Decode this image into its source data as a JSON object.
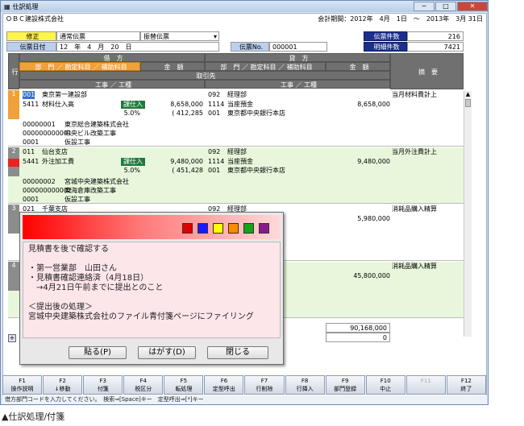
{
  "window": {
    "title": "仕訳処理",
    "company": "ＯＢＣ建設株式会社",
    "period": "会計期間：2012年　4月　1日　～　2013年　3月 31日"
  },
  "header": {
    "mode": "修正",
    "voucher": "通常伝票",
    "transfer": "振替伝票",
    "date_label": "伝票日付",
    "date_value": "12　年　4　月　20　日",
    "voucher_no_label": "伝票No.",
    "voucher_no": "000001",
    "count_label": "伝票件数",
    "count_value": "216",
    "detail_label": "明細件数",
    "detail_value": "7421"
  },
  "columns": {
    "row": "行",
    "debit": "借　方",
    "credit": "貸　方",
    "dept_acct": "部　門 ／ 勘定科目 ／ 補助科目",
    "amount": "金　額",
    "partner": "取引先",
    "project": "工事 ／ 工種",
    "summary": "摘　要"
  },
  "rows": [
    {
      "no": "1",
      "d_dept": "001",
      "d_dept_name": "東京第一建設部",
      "d_acct": "5411",
      "d_acct_name": "材料仕入高",
      "badge": "課仕入",
      "d_amount": "8,658,000",
      "d_tax": "( 412,285",
      "d_rate": "5.0%",
      "c_dept": "092",
      "c_dept_name": "経理部",
      "c_acct": "1114",
      "c_acct_name": "当座預金",
      "c_sub": "001",
      "c_sub_name": "東京都中央銀行本店",
      "c_amount": "8,658,000",
      "summary": "当月材料費計上",
      "p1": "00000001",
      "p1n": "東京総合建築株式会社",
      "p2": "000000000001",
      "p2n": "中央ビル改築工事",
      "p3": "0001",
      "p3n": "仮設工事"
    },
    {
      "no": "2",
      "d_dept": "011",
      "d_dept_name": "仙台支店",
      "d_acct": "5441",
      "d_acct_name": "外注加工費",
      "badge": "課仕入",
      "d_amount": "9,480,000",
      "d_tax": "( 451,428",
      "d_rate": "5.0%",
      "c_dept": "092",
      "c_dept_name": "経理部",
      "c_acct": "1114",
      "c_acct_name": "当座預金",
      "c_sub": "001",
      "c_sub_name": "東京都中央銀行本店",
      "c_amount": "9,480,000",
      "summary": "当月外注費計上",
      "p1": "00000002",
      "p1n": "宮城中央建築株式会社",
      "p2": "000000000002",
      "p2n": "東海倉庫改築工事",
      "p3": "0001",
      "p3n": "仮設工事"
    },
    {
      "no": "3",
      "d_dept": "021",
      "d_dept_name": "千葉支店",
      "c_dept": "092",
      "c_dept_name": "経理部",
      "c_amount": "5,980,000",
      "summary": "消耗品購入精算"
    },
    {
      "no": "4",
      "c_amount": "45,800,000",
      "summary": "消耗品購入精算"
    }
  ],
  "totals": {
    "t1": "90,168,000",
    "t2": "0"
  },
  "popup": {
    "colors": [
      "#e00000",
      "#1a1aff",
      "#ffff00",
      "#ff8a00",
      "#17a317",
      "#8a1a8a"
    ],
    "lines": [
      "見積書を後で確認する",
      "",
      "・第一営業部　山田さん",
      "・見積書確認連絡済（4月18日）",
      "　→4月21日午前までに提出とのこと",
      "",
      "＜提出後の処理＞",
      "宮城中央建築株式会社のファイル青付箋ページにファイリング"
    ],
    "paste": "貼る(P)",
    "peel": "はがす(D)",
    "close": "閉じる"
  },
  "fkeys": [
    {
      "k": "F1",
      "l": "操作説明"
    },
    {
      "k": "F2",
      "l": "↓移動"
    },
    {
      "k": "F3",
      "l": "付箋"
    },
    {
      "k": "F4",
      "l": "税区分"
    },
    {
      "k": "F5",
      "l": "転処理"
    },
    {
      "k": "F6",
      "l": "定型呼出"
    },
    {
      "k": "F7",
      "l": "行削除"
    },
    {
      "k": "F8",
      "l": "行挿入"
    },
    {
      "k": "F9",
      "l": "部門登録"
    },
    {
      "k": "F10",
      "l": "中止"
    },
    {
      "k": "F11",
      "l": ""
    },
    {
      "k": "F12",
      "l": "終了"
    }
  ],
  "status": "借方部門コードを入力してください。　検索⇒[Space]キー　定型呼出⇒[*]キー",
  "caption": "▲仕訳処理/付箋"
}
